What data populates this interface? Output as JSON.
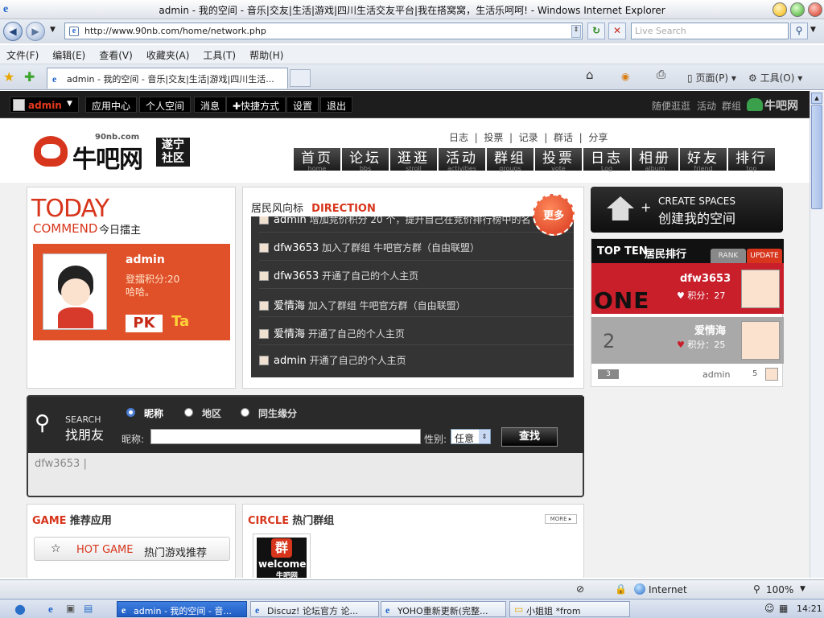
{
  "window": {
    "title": "admin - 我的空间 - 音乐|交友|生活|游戏|四川生活交友平台|我在搭窝窝，生活乐呵呵! - Windows Internet Explorer"
  },
  "browser": {
    "address": "http://www.90nb.com/home/network.php",
    "search_placeholder": "Live Search",
    "menu": [
      "文件(F)",
      "编辑(E)",
      "查看(V)",
      "收藏夹(A)",
      "工具(T)",
      "帮助(H)"
    ],
    "tab_label": "admin - 我的空间 - 音乐|交友|生活|游戏|四川生活...",
    "tools": {
      "page": "页面(P)",
      "tools": "工具(O)"
    }
  },
  "site": {
    "user": "admin",
    "topnav": [
      "应用中心",
      "个人空间",
      "消息",
      "✚快捷方式",
      "设置",
      "退出"
    ],
    "right_links": [
      "随便逛逛",
      "活动",
      "群组"
    ],
    "brand": "牛吧网",
    "logo": {
      "domain": "90nb.com",
      "name": "牛吧网",
      "sub1": "遂宁",
      "sub2": "社区"
    },
    "sublinks": [
      "日志",
      "投票",
      "记录",
      "群话",
      "分享"
    ],
    "mainnav": [
      {
        "cn": "首页",
        "en": "home"
      },
      {
        "cn": "论坛",
        "en": "bbs"
      },
      {
        "cn": "逛逛",
        "en": "stroll"
      },
      {
        "cn": "活动",
        "en": "activities"
      },
      {
        "cn": "群组",
        "en": "groups"
      },
      {
        "cn": "投票",
        "en": "vote"
      },
      {
        "cn": "日志",
        "en": "Log"
      },
      {
        "cn": "相册",
        "en": "album"
      },
      {
        "cn": "好友",
        "en": "friend"
      },
      {
        "cn": "排行",
        "en": "top"
      }
    ]
  },
  "today": {
    "title": "TODAY",
    "sub_en": "COMMEND",
    "sub_cn": "今日擂主",
    "name": "admin",
    "points": "登擂积分:20",
    "motto": "哈哈。",
    "pk": "PK",
    "ta": "Ta"
  },
  "direction": {
    "title_cn": "居民风向标",
    "title_en": "DIRECTION",
    "more": "更多",
    "items": [
      {
        "user": "admin",
        "text": "增加竞价积分 20 个，提升自己在竞价排行榜中的名"
      },
      {
        "user": "dfw3653",
        "text": "加入了群组 牛吧官方群（自由联盟）"
      },
      {
        "user": "dfw3653",
        "text": "开通了自己的个人主页"
      },
      {
        "user": "爱情海",
        "text": "加入了群组 牛吧官方群（自由联盟）"
      },
      {
        "user": "爱情海",
        "text": "开通了自己的个人主页"
      },
      {
        "user": "admin",
        "text": "开通了自己的个人主页"
      }
    ]
  },
  "create": {
    "en": "CREATE SPACES",
    "cn": "创建我的空间"
  },
  "topten": {
    "title_en": "TOP TEN",
    "title_cn": "居民排行",
    "tab_rank": "RANK",
    "tab_update": "UPDATE",
    "points_label": "积分：",
    "entries": [
      {
        "rank": "ONE",
        "name": "dfw3653",
        "points": "27"
      },
      {
        "rank": "2",
        "name": "爱情海",
        "points": "25"
      },
      {
        "rank": "3",
        "name": "admin",
        "points": "5"
      }
    ]
  },
  "search": {
    "en": "SEARCH",
    "cn": "找朋友",
    "options": [
      "昵称",
      "地区",
      "同生缘分"
    ],
    "nick_label": "昵称:",
    "gender_label": "性别:",
    "gender_value": "任意",
    "button": "查找",
    "result": "dfw3653 |"
  },
  "game": {
    "title_en": "GAME",
    "title_cn": "推荐应用",
    "item_en": "HOT GAME",
    "item_cn": "热门游戏推荐"
  },
  "circle": {
    "title_en": "CIRCLE",
    "title_cn": "热门群组",
    "more": "MORE",
    "logo_char": "群",
    "logo_word": "welcome",
    "logo_brand": "牛吧网"
  },
  "status": {
    "zone": "Internet",
    "zoom": "100%"
  },
  "taskbar": {
    "tasks": [
      "admin - 我的空间 - 音...",
      "Discuz! 论坛官方 论...",
      "YOHO重新更新(完整...",
      "小姐姐 *from"
    ],
    "clock": "14:21"
  },
  "colors": {
    "accent": "#d7351c",
    "dark": "#1d1d1d",
    "orange": "#e0512a"
  }
}
